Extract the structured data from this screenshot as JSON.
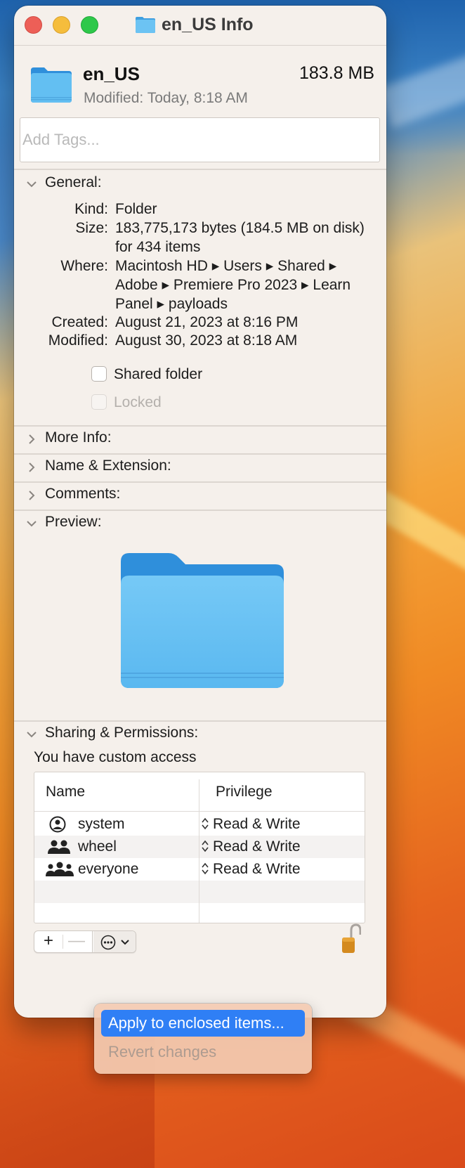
{
  "window": {
    "title": "en_US Info"
  },
  "header": {
    "name": "en_US",
    "size": "183.8 MB",
    "modified_label": "Modified:",
    "modified_value": "Today, 8:18 AM",
    "tags_placeholder": "Add Tags..."
  },
  "general": {
    "section_label": "General:",
    "kind_label": "Kind:",
    "kind_value": "Folder",
    "size_label": "Size:",
    "size_value": "183,775,173 bytes (184.5 MB on disk) for 434 items",
    "where_label": "Where:",
    "where_value": "Macintosh HD ▸ Users ▸ Shared ▸ Adobe ▸ Premiere Pro 2023 ▸ Learn Panel ▸ payloads",
    "created_label": "Created:",
    "created_value": "August 21, 2023 at 8:16 PM",
    "modified_label": "Modified:",
    "modified_value": "August 30, 2023 at 8:18 AM",
    "shared_folder_label": "Shared folder",
    "shared_folder_checked": false,
    "locked_label": "Locked",
    "locked_checked": false
  },
  "sections": {
    "more_info": "More Info:",
    "name_extension": "Name & Extension:",
    "comments": "Comments:",
    "preview": "Preview:",
    "sharing": "Sharing & Permissions:"
  },
  "sharing": {
    "access_text": "You have custom access",
    "columns": [
      "Name",
      "Privilege"
    ],
    "rows": [
      {
        "name": "system",
        "icon": "single-user-icon",
        "privilege": "Read & Write"
      },
      {
        "name": "wheel",
        "icon": "group-icon",
        "privilege": "Read & Write"
      },
      {
        "name": "everyone",
        "icon": "everyone-icon",
        "privilege": "Read & Write"
      }
    ],
    "add_button": "+",
    "remove_button": "—"
  },
  "action_menu": {
    "items": [
      {
        "label": "Apply to enclosed items...",
        "state": "highlighted"
      },
      {
        "label": "Revert changes",
        "state": "disabled"
      }
    ]
  },
  "colors": {
    "accent": "#2f7ff5",
    "folder": "#5ab8f0",
    "close": "#ed5f57",
    "minimize": "#f5bd3c",
    "maximize": "#2ec84a"
  }
}
